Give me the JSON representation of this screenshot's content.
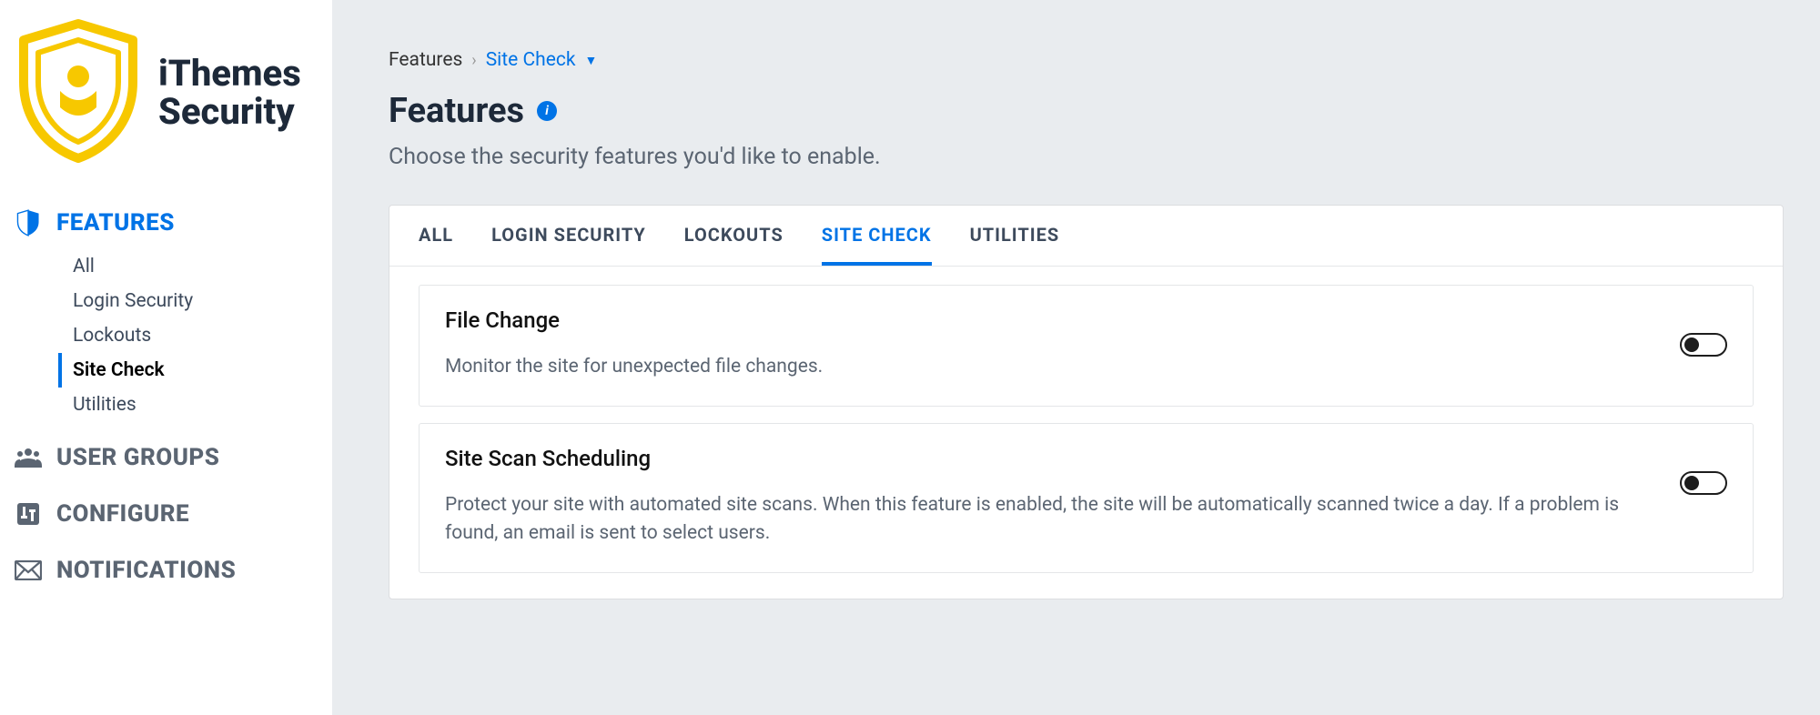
{
  "brand": {
    "name": "iThemes Security"
  },
  "sidebar": {
    "sections": [
      {
        "label": "FEATURES",
        "icon": "shield-icon",
        "active": true,
        "items": [
          {
            "label": "All"
          },
          {
            "label": "Login Security"
          },
          {
            "label": "Lockouts"
          },
          {
            "label": "Site Check",
            "active": true
          },
          {
            "label": "Utilities"
          }
        ]
      },
      {
        "label": "USER GROUPS",
        "icon": "users-icon"
      },
      {
        "label": "CONFIGURE",
        "icon": "sliders-icon"
      },
      {
        "label": "NOTIFICATIONS",
        "icon": "mail-icon"
      }
    ]
  },
  "breadcrumb": {
    "root": "Features",
    "current": "Site Check"
  },
  "page": {
    "title": "Features",
    "subtitle": "Choose the security features you'd like to enable."
  },
  "tabs": [
    {
      "label": "ALL"
    },
    {
      "label": "LOGIN SECURITY"
    },
    {
      "label": "LOCKOUTS"
    },
    {
      "label": "SITE CHECK",
      "active": true
    },
    {
      "label": "UTILITIES"
    }
  ],
  "features": [
    {
      "title": "File Change",
      "desc": "Monitor the site for unexpected file changes.",
      "enabled": false
    },
    {
      "title": "Site Scan Scheduling",
      "desc": "Protect your site with automated site scans. When this feature is enabled, the site will be automatically scanned twice a day. If a problem is found, an email is sent to select users.",
      "enabled": false
    }
  ]
}
